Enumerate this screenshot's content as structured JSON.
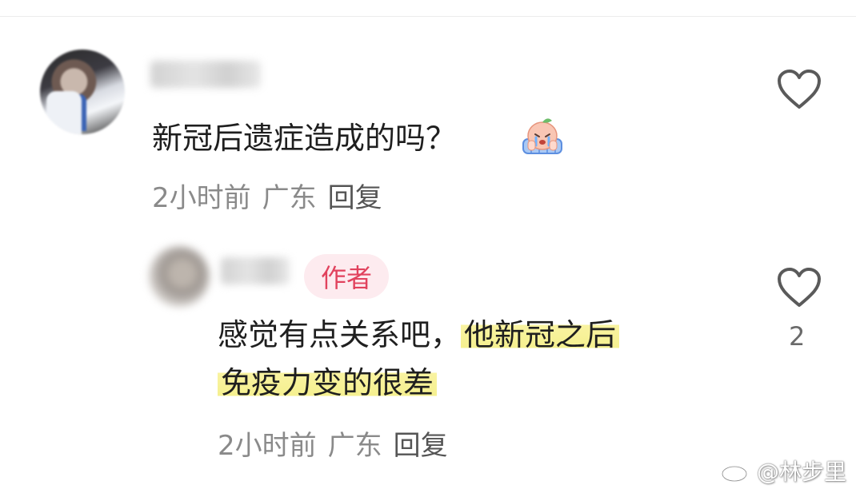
{
  "comments": [
    {
      "text": "新冠后遗症造成的吗？",
      "emoji": "crying-peach-sticker",
      "meta": {
        "time": "2小时前",
        "location": "广东",
        "reply": "回复"
      }
    }
  ],
  "reply_comment": {
    "badge": "作者",
    "line1_plain": "感觉有点关系吧，",
    "line1_highlight": "他新冠之后",
    "line2_highlight": "免疫力变的很差",
    "meta": {
      "time": "2小时前",
      "location": "广东",
      "reply": "回复"
    },
    "like_count": "2"
  },
  "icons": {
    "like": "heart-outline-icon",
    "watermark_logo": "weibo-icon"
  },
  "watermark": {
    "text": "@林步里"
  },
  "colors": {
    "badge_text": "#e1425d",
    "badge_bg": "#fdebef",
    "highlight": "#f5f08f",
    "meta_text": "#8a8a8a"
  }
}
